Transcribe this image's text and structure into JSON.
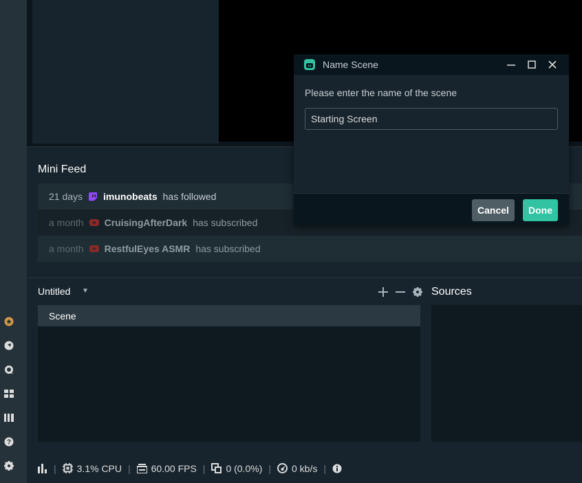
{
  "dialog": {
    "title": "Name Scene",
    "prompt": "Please enter the name of the scene",
    "input_value": "Starting Screen",
    "cancel_label": "Cancel",
    "done_label": "Done"
  },
  "mini_feed": {
    "title": "Mini Feed",
    "items": [
      {
        "time": "21 days",
        "platform": "twitch-icon",
        "name": "imunobeats",
        "action": "has followed"
      },
      {
        "time": "a month",
        "platform": "youtube-icon",
        "name": "CruisingAfterDark",
        "action": "has subscribed"
      },
      {
        "time": "a month",
        "platform": "youtube-icon",
        "name": "RestfulEyes ASMR",
        "action": "has subscribed"
      }
    ]
  },
  "scenes": {
    "collection_name": "Untitled",
    "items": [
      "Scene"
    ]
  },
  "sources": {
    "title": "Sources"
  },
  "status_bar": {
    "cpu": "3.1% CPU",
    "fps": "60.00 FPS",
    "dropped": "0 (0.0%)",
    "bitrate": "0 kb/s"
  },
  "colors": {
    "accent": "#31c3a2",
    "background": "#17242d",
    "twitch": "#9146ff",
    "youtube": "#c4302b"
  }
}
